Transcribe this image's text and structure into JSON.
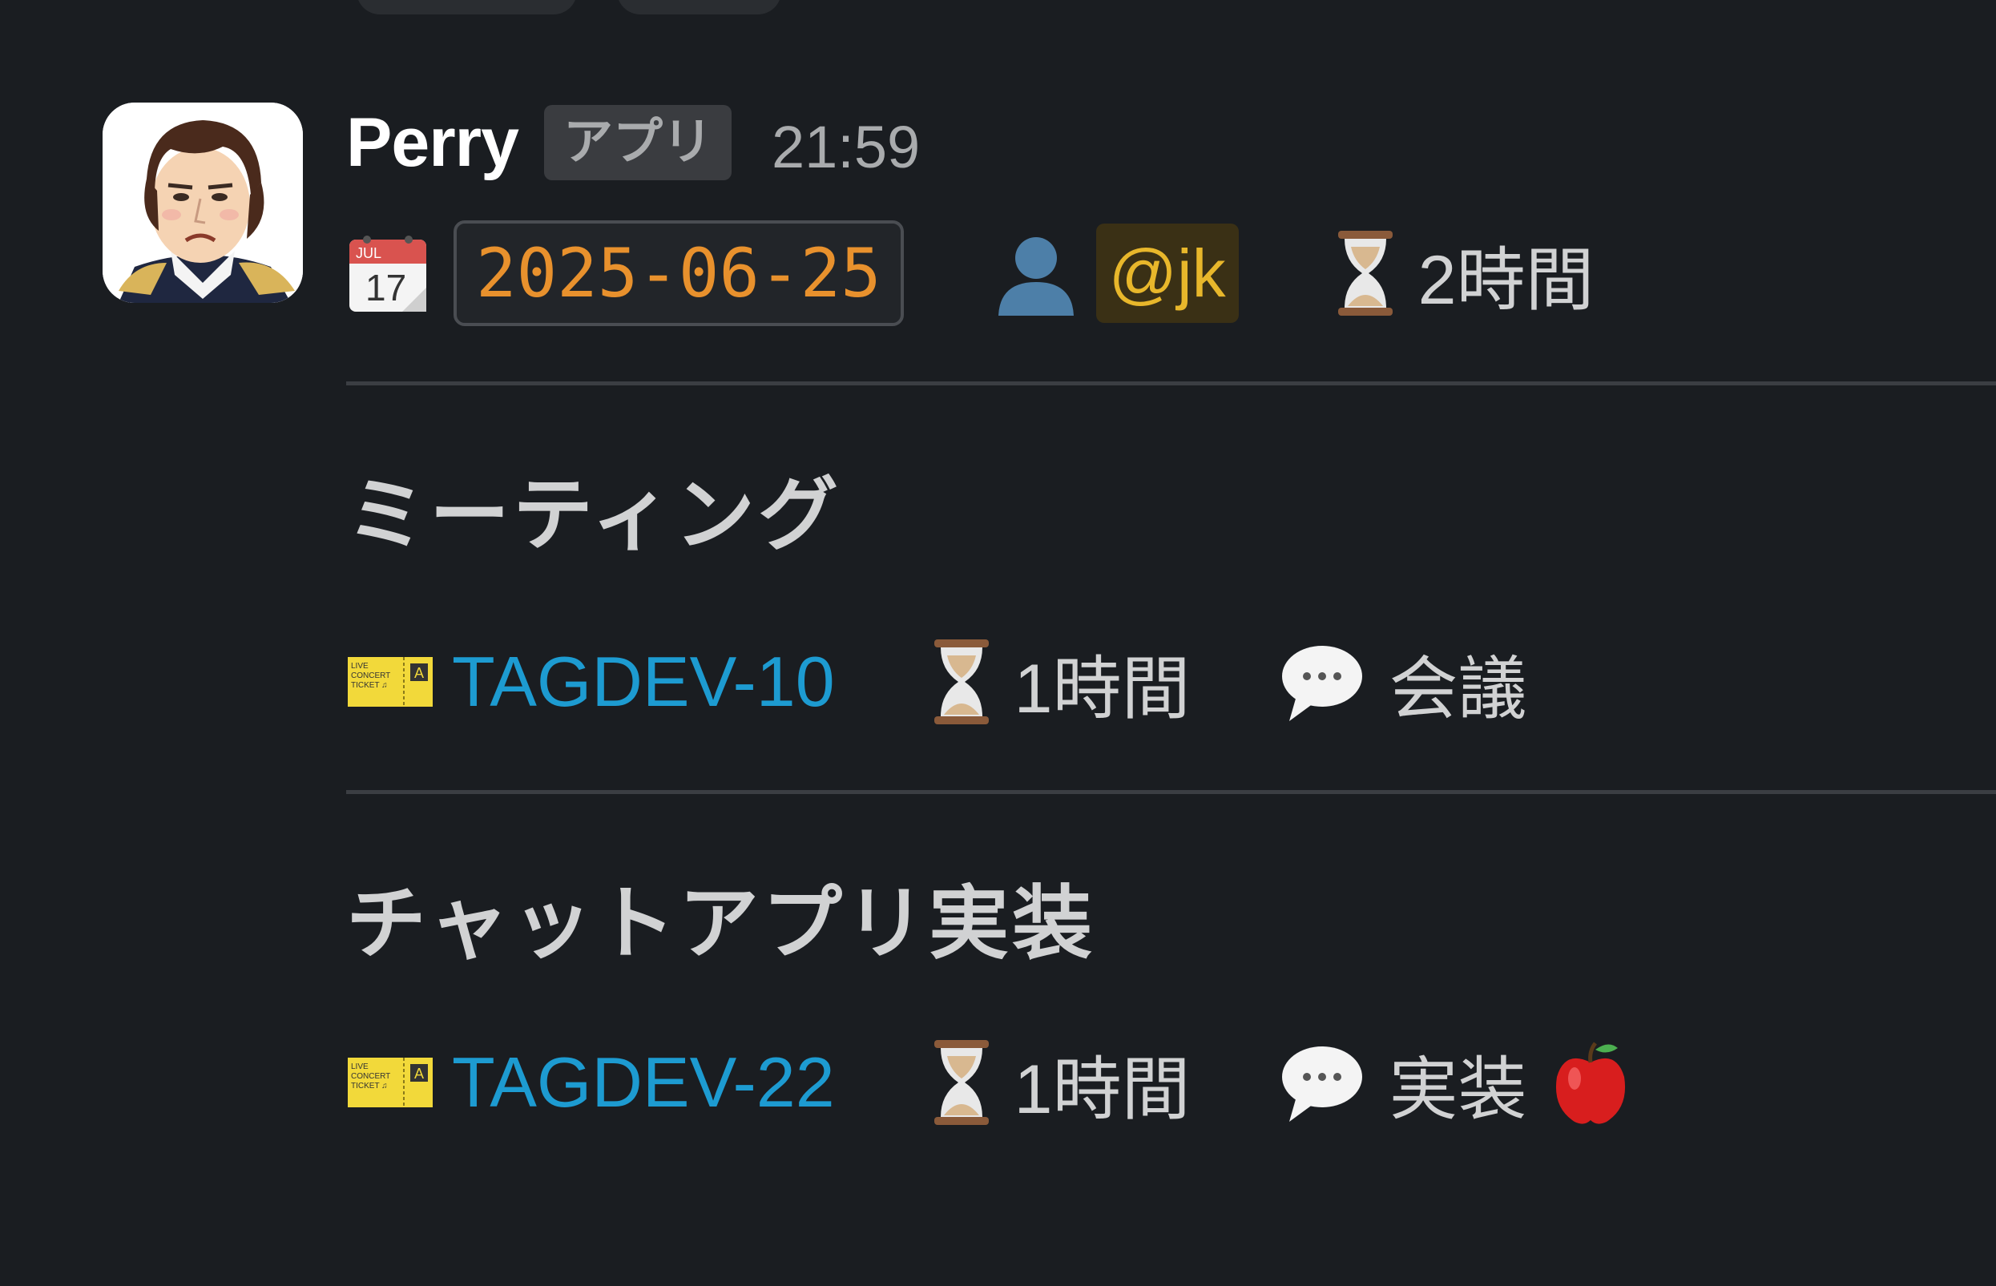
{
  "message": {
    "sender": "Perry",
    "badge": "アプリ",
    "time": "21:59",
    "date_icon": "calendar-icon",
    "date": "2025-06-25",
    "person_icon": "bust-in-silhouette-icon",
    "mention": "@jk",
    "total_duration_icon": "hourglass-icon",
    "total_duration": "2時間"
  },
  "sections": [
    {
      "title": "ミーティング",
      "ticket": "TAGDEV-10",
      "duration": "1時間",
      "category": "会議",
      "category_extra_icon": ""
    },
    {
      "title": "チャットアプリ実装",
      "ticket": "TAGDEV-22",
      "duration": "1時間",
      "category": "実装",
      "category_extra_icon": "red-apple-icon"
    }
  ],
  "colors": {
    "background": "#1a1d21",
    "date": "#e8912d",
    "mention": "#e8b72b",
    "link": "#1d9bd1",
    "divider": "#3b3e43"
  }
}
